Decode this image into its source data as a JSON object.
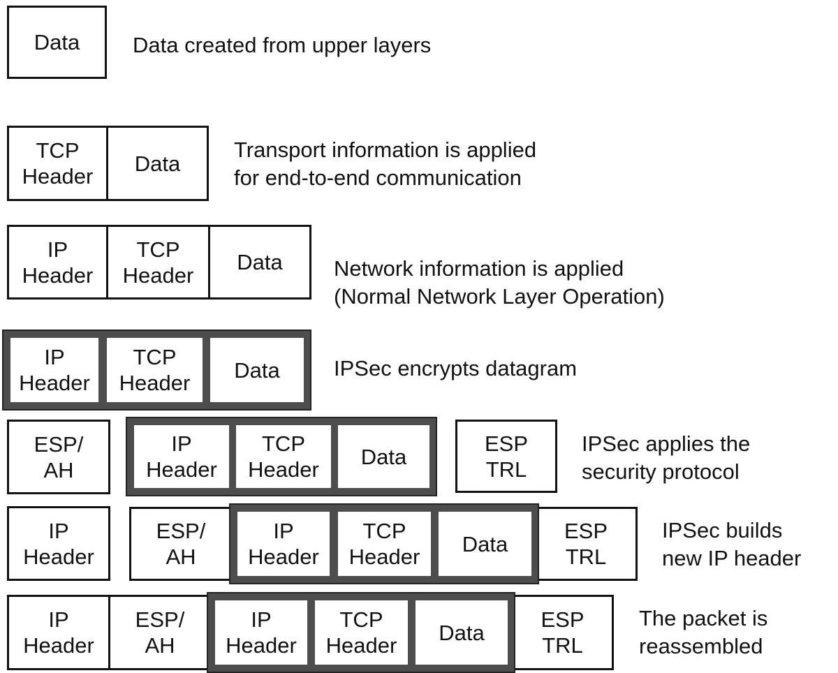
{
  "steps": [
    {
      "caption": "Data created from upper layers",
      "cells": [
        "Data"
      ]
    },
    {
      "caption": "Transport information is applied\nfor end-to-end communication",
      "cells": [
        "TCP\nHeader",
        "Data"
      ]
    },
    {
      "caption": "Network information is applied\n(Normal Network Layer Operation)",
      "cells": [
        "IP\nHeader",
        "TCP\nHeader",
        "Data"
      ]
    },
    {
      "caption": "IPSec encrypts datagram",
      "cells": [
        "IP\nHeader",
        "TCP\nHeader",
        "Data"
      ],
      "encrypted": true
    },
    {
      "caption": "IPSec applies the\nsecurity protocol",
      "cells": [
        "ESP/\nAH",
        "IP\nHeader",
        "TCP\nHeader",
        "Data",
        "ESP\nTRL"
      ]
    },
    {
      "caption": "IPSec builds\nnew IP header",
      "cells": [
        "IP\nHeader",
        "ESP/\nAH",
        "IP\nHeader",
        "TCP\nHeader",
        "Data",
        "ESP\nTRL"
      ]
    },
    {
      "caption": "The packet is\nreassembled",
      "cells": [
        "IP\nHeader",
        "ESP/\nAH",
        "IP\nHeader",
        "TCP\nHeader",
        "Data",
        "ESP\nTRL"
      ]
    }
  ],
  "colors": {
    "encrypted_band": "#4d4d4d",
    "line": "#111111"
  }
}
